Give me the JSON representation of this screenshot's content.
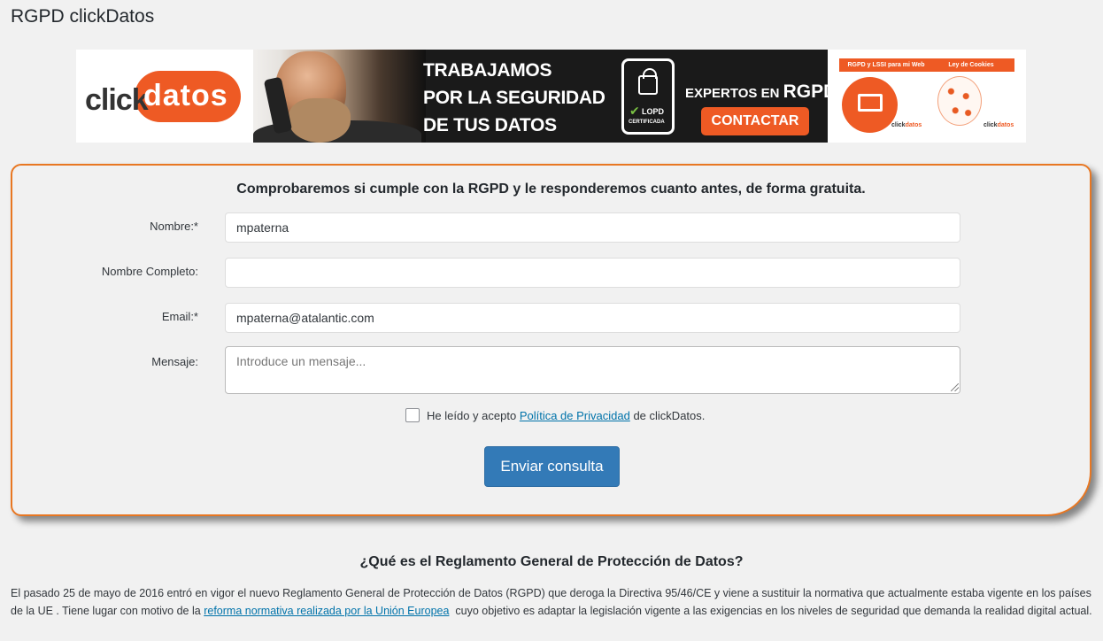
{
  "page": {
    "title": "RGPD clickDatos"
  },
  "banner": {
    "logo_part1": "click",
    "logo_part2": "datos",
    "slogan_line1": "TRABAJAMOS",
    "slogan_line2": "POR LA SEGURIDAD",
    "slogan_line3": "DE TUS DATOS",
    "badge_title": "LOPD",
    "badge_subtitle": "CERTIFICADA",
    "expertos_prefix": "EXPERTOS EN",
    "expertos_brand": "RGPD",
    "cta_label": "CONTACTAR",
    "side_tab1": "RGPD y LSSI para mi Web",
    "side_tab2": "Ley de Cookies",
    "side_mini_logo_a": "click",
    "side_mini_logo_b": "datos",
    "accent_color": "#ee5a24"
  },
  "form": {
    "heading": "Comprobaremos si cumple con la RGPD y le responderemos cuanto antes, de forma gratuita.",
    "fields": {
      "nombre": {
        "label": "Nombre:*",
        "value": "mpaterna"
      },
      "nombre_completo": {
        "label": "Nombre Completo:",
        "value": ""
      },
      "email": {
        "label": "Email:*",
        "value": "mpaterna@atalantic.com"
      },
      "mensaje": {
        "label": "Mensaje:",
        "placeholder": "Introduce un mensaje..."
      }
    },
    "consent": {
      "prefix": "He leído y acepto",
      "link": "Política de Privacidad",
      "suffix": "de clickDatos.",
      "checked": false
    },
    "submit_label": "Enviar consulta",
    "border_color": "#e87722",
    "button_color": "#337ab7"
  },
  "article": {
    "heading": "¿Qué es el Reglamento General de Protección de Datos?",
    "text_part1": "El pasado 25 de mayo de 2016 entró en vigor el nuevo Reglamento General de Protección de Datos (RGPD) que deroga la Directiva 95/46/CE y viene a sustituir la normativa que actualmente estaba vigente en los países de la UE . Tiene lugar con motivo de la",
    "link": "reforma normativa realizada por la Unión Europea",
    "text_part2": "cuyo objetivo es adaptar la legislación vigente a las exigencias en los niveles de seguridad que demanda la realidad digital actual."
  }
}
